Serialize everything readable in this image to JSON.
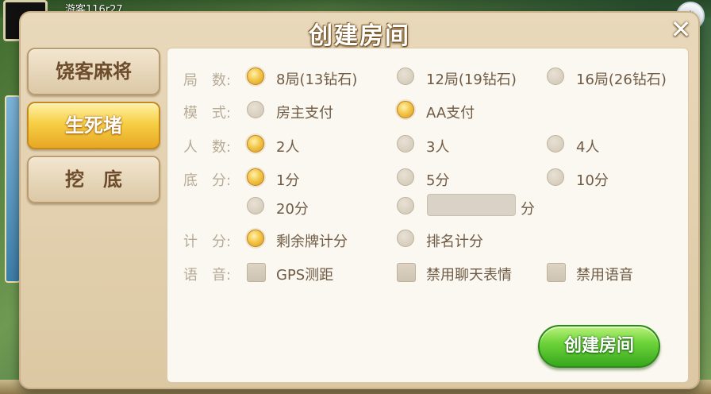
{
  "background": {
    "username": "游客116r27"
  },
  "dialog": {
    "title": "创建房间",
    "close": "✕",
    "tabs": [
      {
        "label": "饶客麻将",
        "active": false
      },
      {
        "label": "生死堵",
        "active": true
      },
      {
        "label": "挖　底",
        "active": false
      }
    ],
    "rows": {
      "rounds": {
        "label": "局　数:",
        "options": [
          "8局(13钻石)",
          "12局(19钻石)",
          "16局(26钻石)"
        ],
        "selected": 0
      },
      "mode": {
        "label": "模　式:",
        "options": [
          "房主支付",
          "AA支付"
        ],
        "selected": 1
      },
      "players": {
        "label": "人　数:",
        "options": [
          "2人",
          "3人",
          "4人"
        ],
        "selected": 0
      },
      "base": {
        "label": "底　分:",
        "options": [
          "1分",
          "5分",
          "10分",
          "20分"
        ],
        "selected": 0,
        "custom_suffix": "分",
        "custom_value": ""
      },
      "scoring": {
        "label": "计　分:",
        "options": [
          "剩余牌计分",
          "排名计分"
        ],
        "selected": 0
      },
      "voice": {
        "label": "语　音:",
        "options": [
          "GPS测距",
          "禁用聊天表情",
          "禁用语音"
        ],
        "checked": [
          false,
          false,
          false
        ]
      }
    },
    "create_button": "创建房间"
  }
}
